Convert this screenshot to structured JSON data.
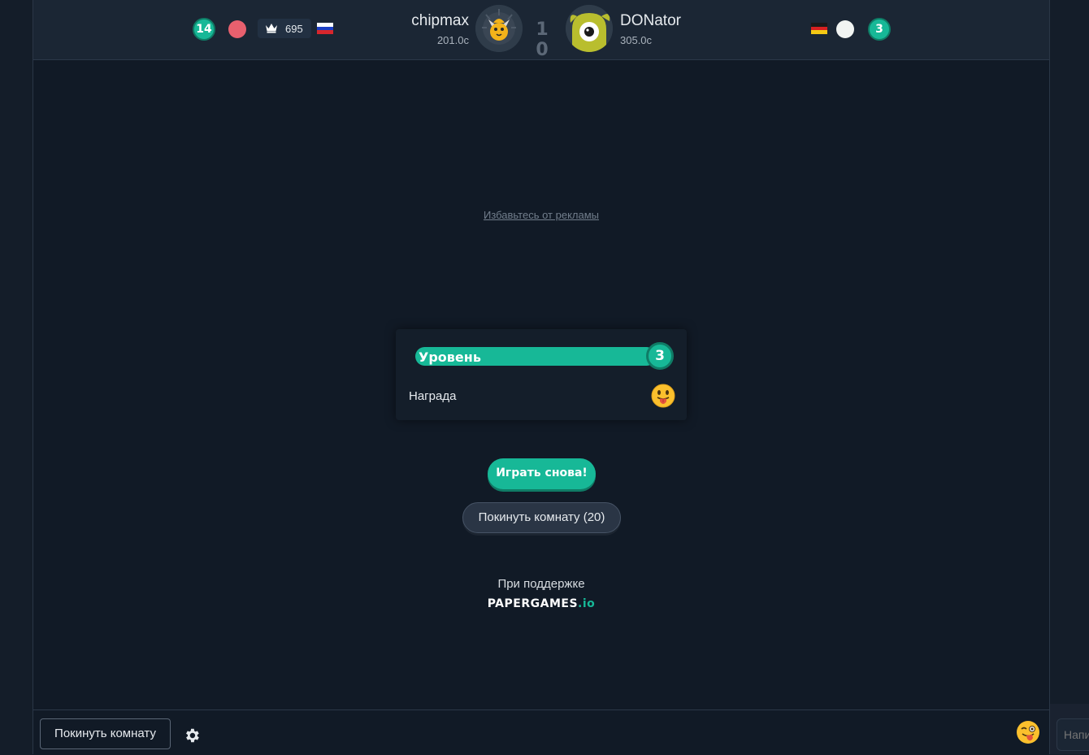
{
  "header": {
    "left_player": {
      "level_badge": "14",
      "color": "#e8606e",
      "rating": "695",
      "name": "chipmax",
      "time": "201.0c",
      "flag": "ru-flag"
    },
    "score": "1 0",
    "right_player": {
      "level_badge": "3",
      "color": "#f1f4f2",
      "name": "DONator",
      "time": "305.0c",
      "flag": "de-flag"
    }
  },
  "main": {
    "ad_link": "Избавьтесь от рекламы",
    "level_card": {
      "label": "Уровень",
      "level": "3",
      "progress": 1.0,
      "reward_label": "Награда",
      "reward_icon": "tongue-emoji-icon"
    },
    "play_again": "Играть снова!",
    "leave_room_countdown": "Покинуть комнату  (20)",
    "powered_by": "При поддержке",
    "brand": {
      "name": "PaperGames",
      "tld": ".io"
    }
  },
  "footer": {
    "leave_room": "Покинуть комнату",
    "settings_icon": "gear-icon",
    "chat_emoji_icon": "winking-tongue-emoji-icon",
    "chat_placeholder": "Напишите сообщение"
  },
  "colors": {
    "accent": "#17b897",
    "accent_dark": "#0f7c66",
    "background": "#111a26",
    "header": "#1b2634"
  }
}
